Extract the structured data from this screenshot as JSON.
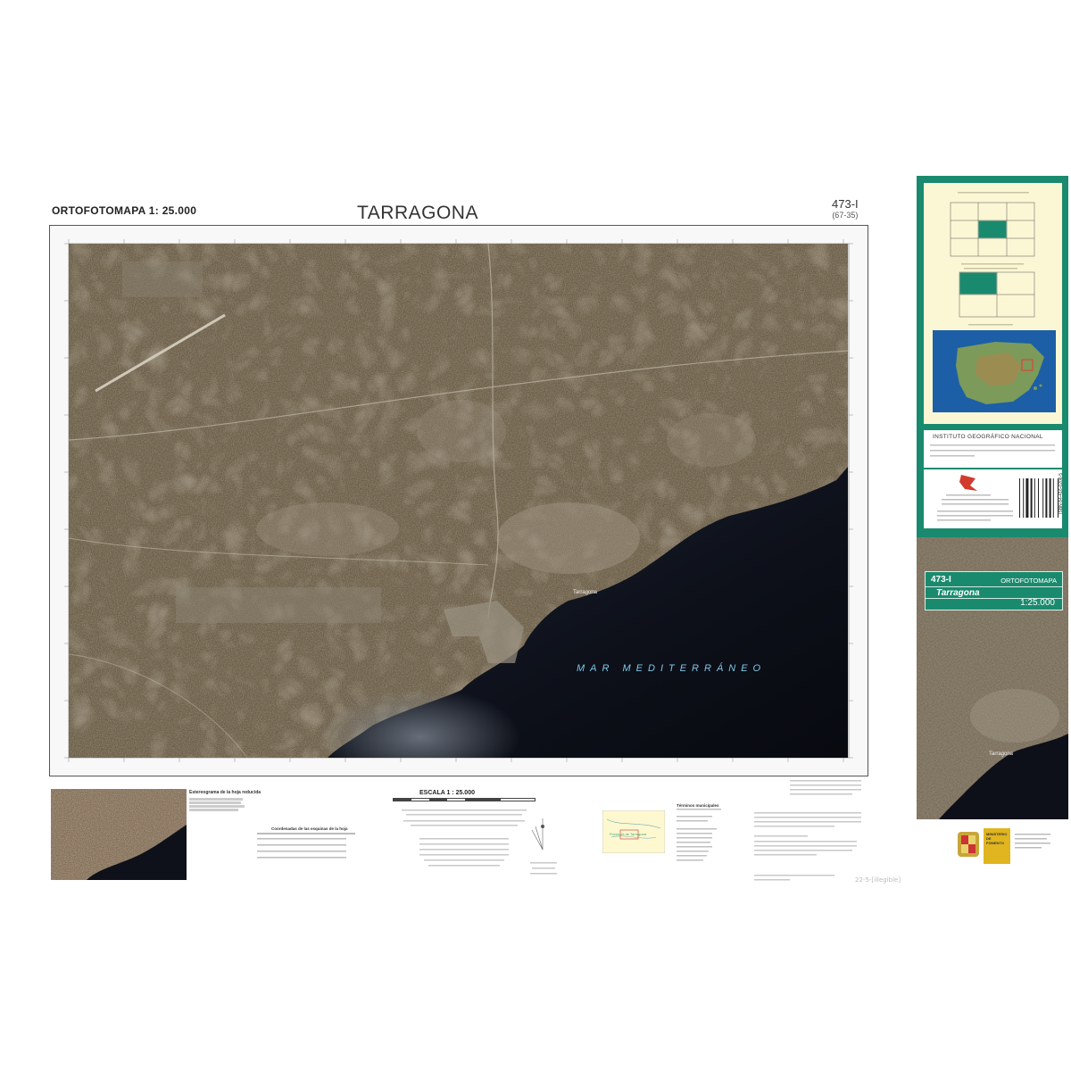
{
  "header": {
    "series": "ORTOFOTOMAPA 1: 25.000",
    "title": "TARRAGONA",
    "sheet_number": "473-I",
    "sheet_code": "(67-35)"
  },
  "map": {
    "sea_label": "MAR MEDITERRÁNEO",
    "city_label": "Tarragona"
  },
  "legend": {
    "stereogram_title": "Estereograma de la hoja reducida",
    "corners_title": "Coordenadas de las esquinas de la hoja",
    "scale_title": "ESCALA 1 : 25.000",
    "municipalities_title": "Términos municipales",
    "province_label": "Provincia de Tarragona"
  },
  "cover": {
    "institute": "INSTITUTO GEOGRÁFICO NACIONAL",
    "sheet_number": "473-I",
    "series": "ORTOFOTOMAPA",
    "title": "Tarragona",
    "scale": "1:25.000",
    "ministry": "MINISTERIO DE FOMENTO",
    "isbn": "ISBN 84-416-0206-5"
  },
  "handwritten_note": "22-5-[illegible]",
  "colors": {
    "cover_green": "#1a8a6e",
    "cover_cream": "#fbf7d5",
    "sea": "#10131c",
    "land": "#6b5e48",
    "sea_label": "#7ec8e8"
  }
}
